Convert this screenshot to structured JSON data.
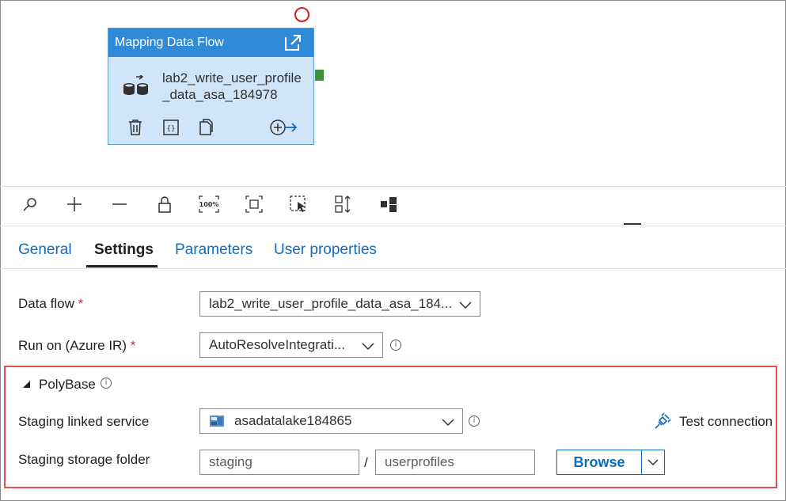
{
  "node": {
    "type_label": "Mapping Data Flow",
    "name_line1": "lab2_write_user_profile",
    "name_line2": "_data_asa_184978"
  },
  "toolbar": {
    "icons": [
      "search-icon",
      "zoom-in-icon",
      "zoom-out-icon",
      "lock-icon",
      "zoom-100-icon",
      "fit-icon",
      "select-icon",
      "auto-align-icon",
      "layout-icon"
    ],
    "zoom_100_label": "100%"
  },
  "tabs": [
    {
      "label": "General",
      "active": false
    },
    {
      "label": "Settings",
      "active": true
    },
    {
      "label": "Parameters",
      "active": false
    },
    {
      "label": "User properties",
      "active": false
    }
  ],
  "form": {
    "data_flow": {
      "label": "Data flow",
      "required": "*",
      "value": "lab2_write_user_profile_data_asa_184..."
    },
    "run_on": {
      "label": "Run on (Azure IR)",
      "required": "*",
      "value": "AutoResolveIntegrati..."
    },
    "polybase": {
      "label": "PolyBase"
    },
    "staging_linked_service": {
      "label": "Staging linked service",
      "value": "asadatalake184865"
    },
    "test_connection": {
      "label": "Test connection"
    },
    "staging_storage_folder": {
      "label": "Staging storage folder",
      "container": "staging",
      "separator": "/",
      "directory": "userprofiles"
    },
    "browse": {
      "label": "Browse"
    }
  },
  "colors": {
    "accent": "#0f6cbd",
    "node_header": "#2f8ad8",
    "node_body": "#cfe6fa",
    "highlight": "#e05050",
    "required": "#c4314b"
  }
}
